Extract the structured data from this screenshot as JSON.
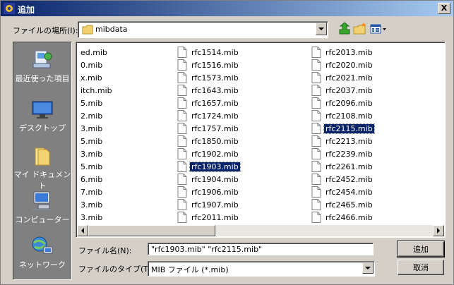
{
  "window": {
    "title": "追加",
    "close_label": "X"
  },
  "lookin": {
    "label": "ファイルの場所(I):",
    "value": "mibdata"
  },
  "places": [
    {
      "label": "最近使った項目"
    },
    {
      "label": "デスクトップ"
    },
    {
      "label": "マイ ドキュメント"
    },
    {
      "label": "コンピューター"
    },
    {
      "label": "ネットワーク"
    }
  ],
  "files": {
    "col0": [
      "ed.mib",
      "0.mib",
      "x.mib",
      "itch.mib",
      "5.mib",
      "2.mib",
      "3.mib",
      "5.mib",
      "3.mib",
      "5.mib",
      "6.mib",
      "7.mib",
      "3.mib",
      "3.mib"
    ],
    "col1": [
      "rfc1514.mib",
      "rfc1516.mib",
      "rfc1573.mib",
      "rfc1643.mib",
      "rfc1657.mib",
      "rfc1724.mib",
      "rfc1757.mib",
      "rfc1850.mib",
      "rfc1902.mib",
      "rfc1903.mib",
      "rfc1904.mib",
      "rfc1906.mib",
      "rfc1907.mib",
      "rfc2011.mib"
    ],
    "col2": [
      "rfc2013.mib",
      "rfc2020.mib",
      "rfc2021.mib",
      "rfc2037.mib",
      "rfc2096.mib",
      "rfc2108.mib",
      "rfc2115.mib",
      "rfc2213.mib",
      "rfc2239.mib",
      "rfc2261.mib",
      "rfc2452.mib",
      "rfc2454.mib",
      "rfc2465.mib",
      "rfc2466.mib"
    ]
  },
  "filename": {
    "label": "ファイル名(N):",
    "value": "\"rfc1903.mib\" \"rfc2115.mib\""
  },
  "filetype": {
    "label": "ファイルのタイプ(T):",
    "value": "MIB ファイル (*.mib)"
  },
  "buttons": {
    "ok": "追加",
    "cancel": "取消"
  }
}
